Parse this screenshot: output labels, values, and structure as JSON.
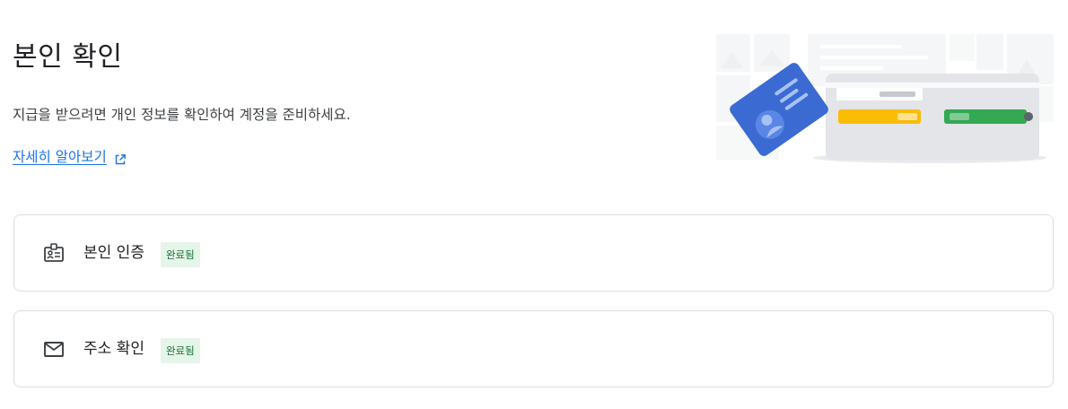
{
  "page": {
    "title": "본인 확인",
    "description": "지급을 받으려면 개인 정보를 확인하여 계정을 준비하세요.",
    "learn_more": "자세히 알아보기"
  },
  "illustration": {
    "name": "id-card-and-wallet-illustration",
    "colors": {
      "card_blue": "#3f6fd8",
      "wallet_gray": "#e8eaed",
      "yellow_card": "#fbbc04",
      "green_card": "#34a853"
    }
  },
  "items": [
    {
      "label": "본인 인증",
      "status": "완료됨",
      "icon": "id-badge-icon"
    },
    {
      "label": "주소 확인",
      "status": "완료됨",
      "icon": "mail-icon"
    }
  ],
  "colors": {
    "link": "#1a73e8",
    "badge_bg": "#e6f4ea",
    "badge_text": "#137333",
    "border": "#dadce0"
  }
}
